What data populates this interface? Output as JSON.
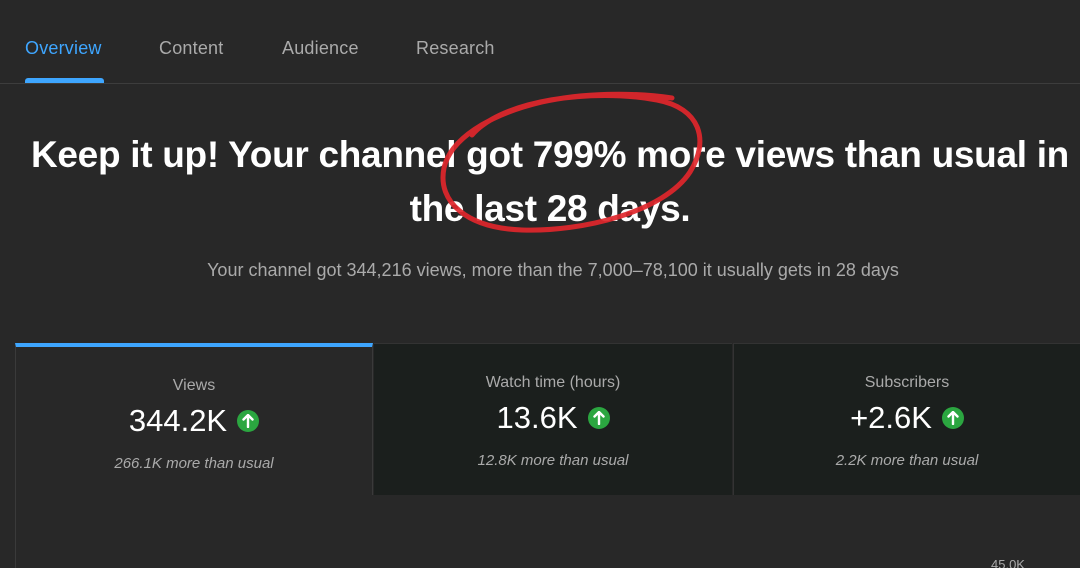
{
  "tabs": [
    {
      "label": "Overview",
      "active": true
    },
    {
      "label": "Content",
      "active": false
    },
    {
      "label": "Audience",
      "active": false
    },
    {
      "label": "Research",
      "active": false
    }
  ],
  "headline": {
    "line1": "Keep it up! Your channel got 799% more views than usual in",
    "line2": "the last 28 days."
  },
  "subline": "Your channel got 344,216 views, more than the 7,000–78,100 it usually gets in 28 days",
  "metrics": [
    {
      "label": "Views",
      "value": "344.2K",
      "note": "266.1K more than usual",
      "selected": true
    },
    {
      "label": "Watch time (hours)",
      "value": "13.6K",
      "note": "12.8K more than usual",
      "selected": false
    },
    {
      "label": "Subscribers",
      "value": "+2.6K",
      "note": "2.2K more than usual",
      "selected": false
    }
  ],
  "chart": {
    "top_tick": "45.0K"
  },
  "colors": {
    "accent": "#3ea6ff",
    "up": "#2ba640",
    "annotation": "#e0262b"
  },
  "icons": {
    "trend": "arrow-up-circle-icon"
  }
}
